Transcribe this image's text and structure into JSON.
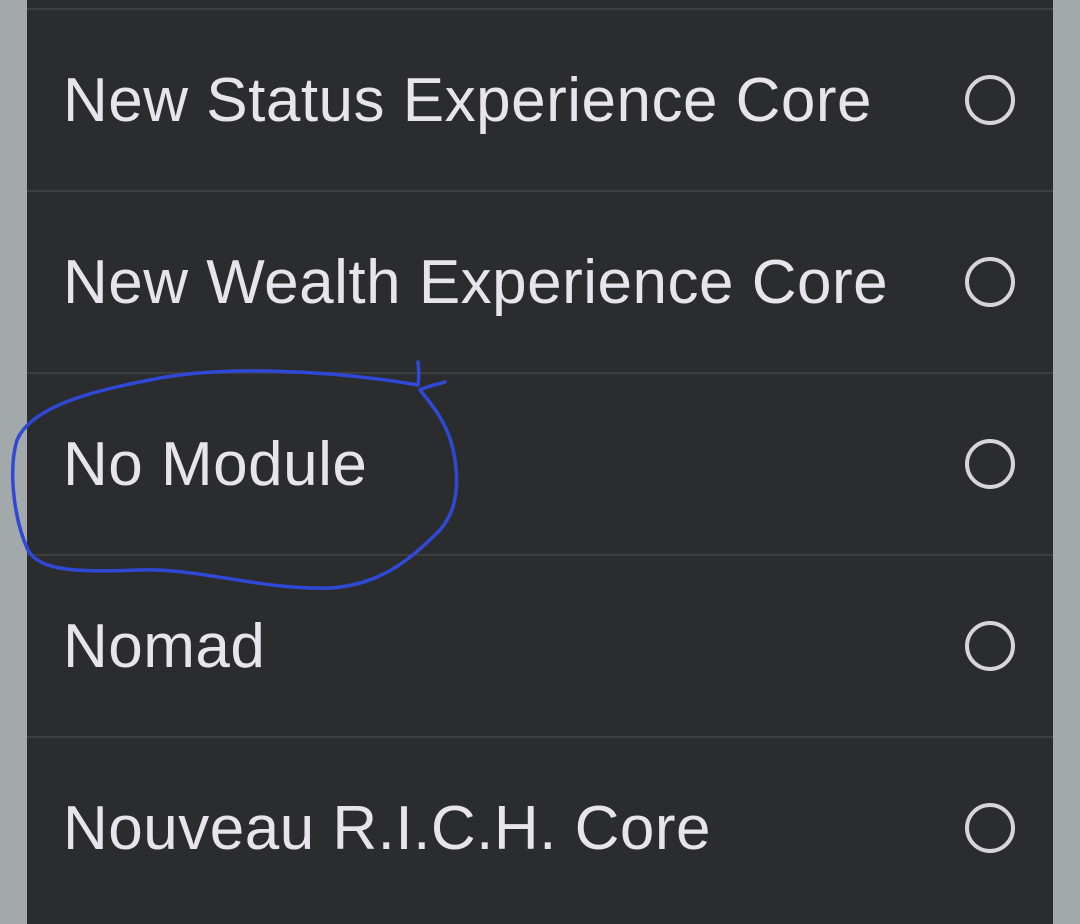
{
  "picker": {
    "options": [
      {
        "label": "New Status Experience Core",
        "selected": false
      },
      {
        "label": "New Wealth Experience Core",
        "selected": false
      },
      {
        "label": "No Module",
        "selected": false
      },
      {
        "label": "Nomad",
        "selected": false
      },
      {
        "label": "Nouveau R.I.C.H. Core",
        "selected": false
      }
    ]
  },
  "annotation": {
    "type": "hand-drawn circle",
    "color": "#2f49d6",
    "circled_option": "No Module"
  },
  "colors": {
    "dialog_background": "#2b2c2e",
    "divider": "#3d3e41",
    "text": "#e8e4ec",
    "radio_outline": "#d7d4da",
    "scrim": "#a3a8ab"
  }
}
